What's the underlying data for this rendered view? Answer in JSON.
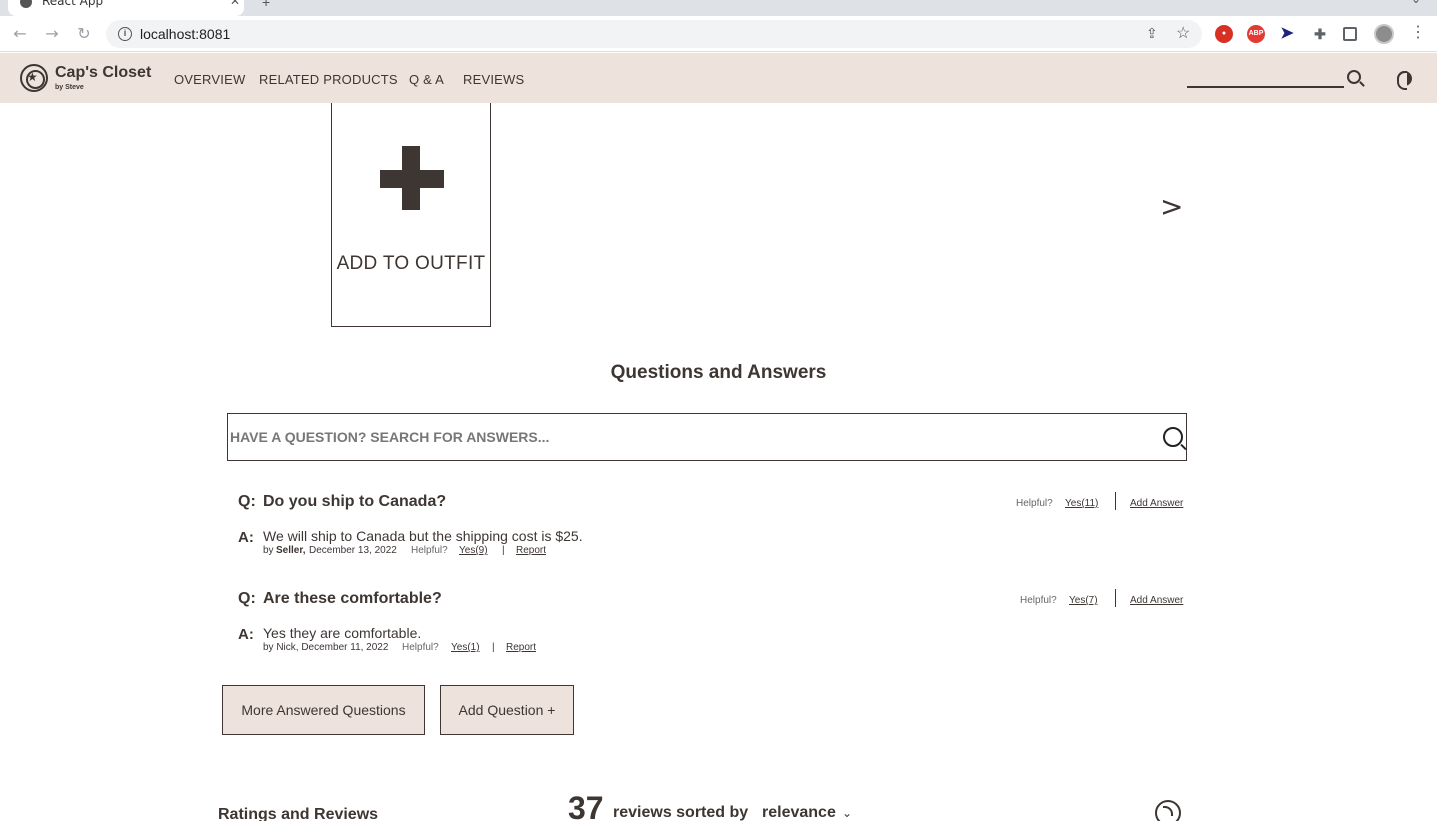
{
  "browser": {
    "tab_title": "React App",
    "url": "localhost:8081"
  },
  "header": {
    "logo_title": "Cap's Closet",
    "logo_subtitle": "by Steve",
    "nav": [
      "OVERVIEW",
      "RELATED PRODUCTS",
      "Q & A",
      "REVIEWS"
    ]
  },
  "outfit": {
    "add_label": "ADD TO OUTFIT",
    "next_arrow": ">"
  },
  "qa": {
    "title": "Questions and Answers",
    "search_placeholder": "HAVE A QUESTION? SEARCH FOR ANSWERS...",
    "questions": [
      {
        "q_label": "Q:",
        "question": "Do you ship to Canada?",
        "helpful_label": "Helpful?",
        "yes": "Yes(11)",
        "add_answer": "Add Answer",
        "a_label": "A:",
        "answer": "We will ship to Canada but the shipping cost is $25.",
        "by": "by",
        "answerer": "Seller,",
        "date": "December 13, 2022",
        "a_helpful_label": "Helpful?",
        "a_yes": "Yes(9)",
        "sep": "|",
        "report": "Report"
      },
      {
        "q_label": "Q:",
        "question": "Are these comfortable?",
        "helpful_label": "Helpful?",
        "yes": "Yes(7)",
        "add_answer": "Add Answer",
        "a_label": "A:",
        "answer": "Yes they are comfortable.",
        "by_line": "by Nick, December 11, 2022",
        "a_helpful_label": "Helpful?",
        "a_yes": "Yes(1)",
        "sep": "|",
        "report": "Report"
      }
    ],
    "more_button": "More Answered Questions",
    "add_question_button": "Add Question +"
  },
  "reviews": {
    "title": "Ratings and Reviews",
    "count": "37",
    "sorted_by": "reviews sorted by",
    "sort_value": "relevance"
  }
}
